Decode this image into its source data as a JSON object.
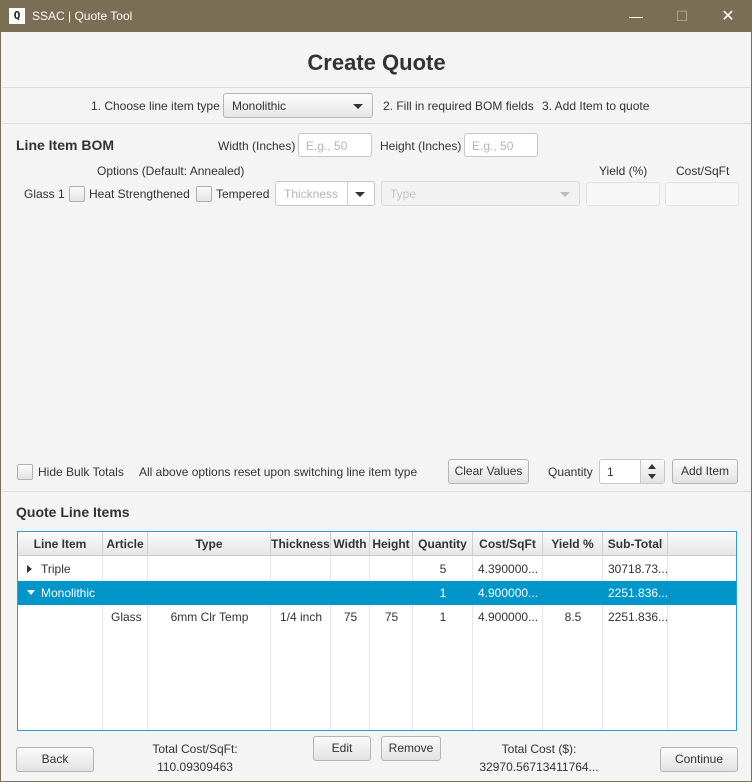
{
  "window": {
    "title": "SSAC | Quote Tool",
    "icon_letter": "Q",
    "min": "—",
    "max": "☐",
    "close": "✕"
  },
  "header": {
    "title": "Create Quote"
  },
  "steps": {
    "step1": "1. Choose line item type",
    "line_item_type": "Monolithic",
    "step2": "2. Fill in required BOM fields",
    "step3": "3. Add Item to quote"
  },
  "bom": {
    "title": "Line Item BOM",
    "width_label": "Width (Inches)",
    "width_placeholder": "E.g., 50",
    "height_label": "Height (Inches)",
    "height_placeholder": "E.g., 50",
    "options_label": "Options (Default: Annealed)",
    "yield_label": "Yield (%)",
    "cost_label": "Cost/SqFt",
    "row_label": "Glass 1",
    "heat_label": "Heat Strengthened",
    "tempered_label": "Tempered",
    "thickness_placeholder": "Thickness",
    "type_placeholder": "Type"
  },
  "bulk": {
    "hide_label": "Hide Bulk Totals",
    "reset_note": "All above options reset upon switching line item type",
    "clear_button": "Clear Values",
    "quantity_label": "Quantity",
    "quantity_value": "1",
    "add_button": "Add Item"
  },
  "quote": {
    "title": "Quote Line Items",
    "columns": [
      "Line Item",
      "Article",
      "Type",
      "Thickness",
      "Width",
      "Height",
      "Quantity",
      "Cost/SqFt",
      "Yield %",
      "Sub-Total"
    ],
    "rows": [
      {
        "line_item": "Triple",
        "article": "",
        "type": "",
        "thickness": "",
        "width": "",
        "height": "",
        "quantity": "5",
        "cost": "4.390000...",
        "yield": "",
        "subtotal": "30718.73..."
      },
      {
        "line_item": "Monolithic",
        "article": "",
        "type": "",
        "thickness": "",
        "width": "",
        "height": "",
        "quantity": "1",
        "cost": "4.900000...",
        "yield": "",
        "subtotal": "2251.836..."
      },
      {
        "line_item": "",
        "article": "Glass",
        "type": "6mm Clr Temp",
        "thickness": "1/4 inch",
        "width": "75",
        "height": "75",
        "quantity": "1",
        "cost": "4.900000...",
        "yield": "8.5",
        "subtotal": "2251.836..."
      }
    ]
  },
  "footer": {
    "back": "Back",
    "total_cost_sqft_label": "Total Cost/SqFt:",
    "total_cost_sqft_value": "110.09309463",
    "edit": "Edit",
    "remove": "Remove",
    "total_cost_label": "Total Cost ($):",
    "total_cost_value": "32970.56713411764...",
    "continue": "Continue"
  },
  "colors": {
    "titlebar": "#7a6e55",
    "selection": "#0096c9",
    "table_border": "#2a9fd6"
  }
}
